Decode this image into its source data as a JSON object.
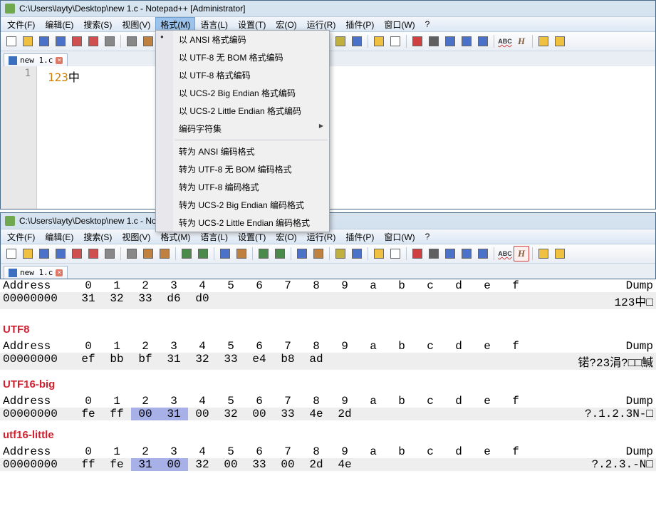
{
  "window1": {
    "title_path": "C:\\Users\\layty\\Desktop\\new 1.c - Notepad++ [Administrator]",
    "menu": [
      "文件(F)",
      "编辑(E)",
      "搜索(S)",
      "视图(V)",
      "格式(M)",
      "语言(L)",
      "设置(T)",
      "宏(O)",
      "运行(R)",
      "插件(P)",
      "窗口(W)",
      "?"
    ],
    "active_menu_idx": 4,
    "dropdown_groups": [
      [
        "以 ANSI 格式编码",
        "以 UTF-8 无 BOM 格式编码",
        "以 UTF-8 格式编码",
        "以 UCS-2 Big Endian 格式编码",
        "以 UCS-2 Little Endian 格式编码",
        "编码字符集"
      ],
      [
        "转为 ANSI 编码格式",
        "转为 UTF-8 无 BOM 编码格式",
        "转为 UTF-8 编码格式",
        "转为 UCS-2 Big Endian 编码格式",
        "转为 UCS-2 Little Endian 编码格式"
      ]
    ],
    "dropdown_bullet_idx": 0,
    "dropdown_arrow_idx": 5,
    "tab_label": "new 1.c",
    "editor_line_no": "1",
    "editor_num": "123",
    "editor_zh": "中"
  },
  "window2": {
    "title_path": "C:\\Users\\layty\\Desktop\\new 1.c - Notepad++ [Administrator]",
    "menu": [
      "文件(F)",
      "编辑(E)",
      "搜索(S)",
      "视图(V)",
      "格式(M)",
      "语言(L)",
      "设置(T)",
      "宏(O)",
      "运行(R)",
      "插件(P)",
      "窗口(W)",
      "?"
    ],
    "tab_label": "new 1.c"
  },
  "hex": {
    "header_cols": [
      "0",
      "1",
      "2",
      "3",
      "4",
      "5",
      "6",
      "7",
      "8",
      "9",
      "a",
      "b",
      "c",
      "d",
      "e",
      "f"
    ],
    "addr_label": "Address",
    "dump_label": "Dump",
    "blocks": [
      {
        "label": "",
        "rows": [
          {
            "addr": "00000000",
            "bytes": [
              "31",
              "32",
              "33",
              "d6",
              "d0"
            ],
            "hl": [],
            "dump": "123中□"
          }
        ]
      },
      {
        "label": "UTF8",
        "rows": [
          {
            "addr": "00000000",
            "bytes": [
              "ef",
              "bb",
              "bf",
              "31",
              "32",
              "33",
              "e4",
              "b8",
              "ad"
            ],
            "hl": [],
            "dump": "锘?23涓?□□鰔"
          }
        ]
      },
      {
        "label": "UTF16-big",
        "rows": [
          {
            "addr": "00000000",
            "bytes": [
              "fe",
              "ff",
              "00",
              "31",
              "00",
              "32",
              "00",
              "33",
              "4e",
              "2d"
            ],
            "hl": [
              2,
              3
            ],
            "dump": "?.1.2.3N-□"
          }
        ]
      },
      {
        "label": "utf16-little",
        "rows": [
          {
            "addr": "00000000",
            "bytes": [
              "ff",
              "fe",
              "31",
              "00",
              "32",
              "00",
              "33",
              "00",
              "2d",
              "4e"
            ],
            "hl": [
              2,
              3
            ],
            "dump": "?.2.3.-N□"
          }
        ]
      }
    ]
  },
  "toolbar_icons": [
    "new",
    "open",
    "save",
    "saveall",
    "close",
    "closeall",
    "print",
    "sep",
    "cut",
    "copy",
    "paste",
    "sep",
    "undo",
    "redo",
    "sep",
    "find",
    "replace",
    "sep",
    "zoomin",
    "zoomout",
    "sep",
    "sync",
    "wrap",
    "sep",
    "invis",
    "indent",
    "sep",
    "folder",
    "doc",
    "sep",
    "macro-rec",
    "macro-stop",
    "macro-play",
    "macro-fast",
    "macro-save",
    "sep",
    "abc",
    "H",
    "sep",
    "fold",
    "unfold"
  ],
  "toolbar_colors": {
    "new": "#fff",
    "open": "#f0c040",
    "save": "#4a72c8",
    "saveall": "#4a72c8",
    "close": "#d05050",
    "closeall": "#d05050",
    "print": "#888",
    "cut": "#888",
    "copy": "#c08040",
    "paste": "#c08040",
    "undo": "#4a8a4a",
    "redo": "#4a8a4a",
    "find": "#4a72c8",
    "replace": "#c08040",
    "zoomin": "#4a8a4a",
    "zoomout": "#4a8a4a",
    "sync": "#4a72c8",
    "wrap": "#c08040",
    "invis": "#c0b040",
    "indent": "#4a72c8",
    "folder": "#f0c040",
    "doc": "#fff",
    "macro-rec": "#d04040",
    "macro-stop": "#606060",
    "macro-play": "#4a72c8",
    "macro-fast": "#4a72c8",
    "macro-save": "#4a72c8",
    "abc": "#d04040",
    "H": "#806040",
    "fold": "#f0c040",
    "unfold": "#f0c040"
  }
}
